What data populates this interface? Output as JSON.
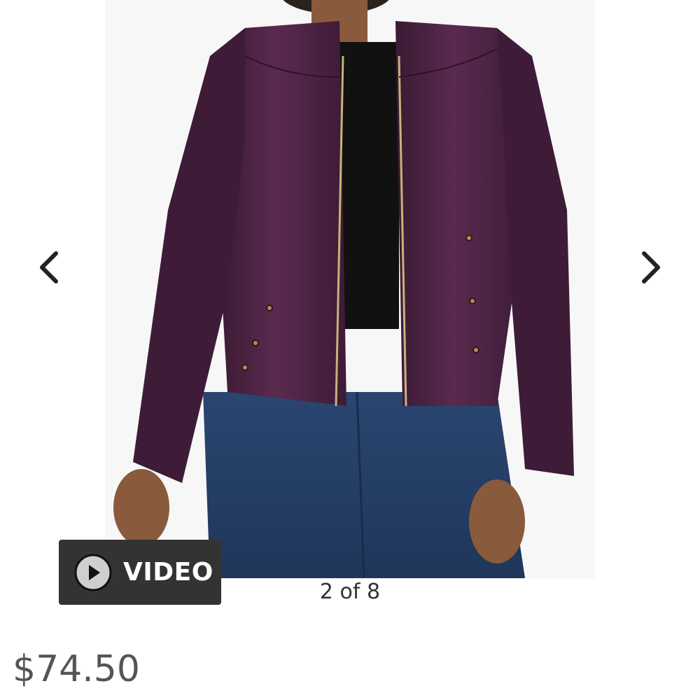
{
  "gallery": {
    "counter_text": "2 of 8",
    "video_label": "VIDEO",
    "prev_icon": "chevron-left-icon",
    "next_icon": "chevron-right-icon",
    "play_icon": "play-circle-icon"
  },
  "product": {
    "price": "$74.50"
  },
  "colors": {
    "jacket": "#4a2040",
    "denim": "#2c4670",
    "video_button_bg": "#333333",
    "price_text": "#555555"
  }
}
